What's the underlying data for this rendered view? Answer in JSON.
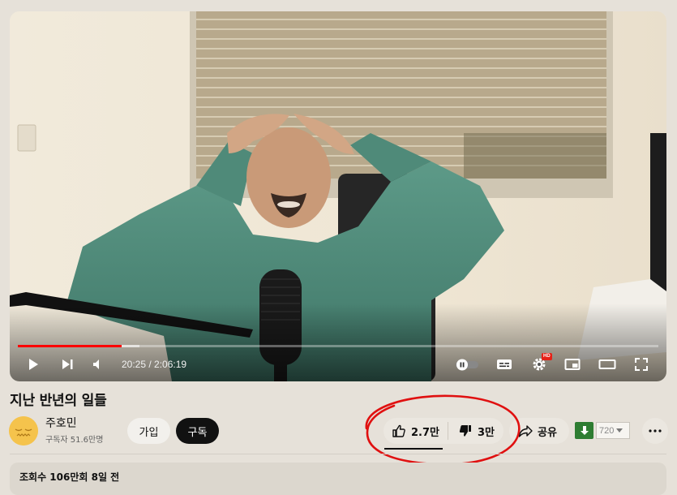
{
  "player": {
    "progress_fraction": 0.162,
    "buffer_fraction": 0.19,
    "time_display": "20:25 / 2:06:19",
    "hd_badge": "HD",
    "controls": [
      "play-icon",
      "next-icon",
      "volume-icon",
      "autoplay-toggle-icon",
      "subtitles-icon",
      "settings-icon",
      "miniplayer-icon",
      "theater-mode-icon",
      "fullscreen-icon"
    ]
  },
  "video": {
    "title": "지난 반년의 일들"
  },
  "channel": {
    "name": "주호민",
    "subscribers": "구독자 51.6만명",
    "join_label": "가입",
    "subscribe_label": "구독"
  },
  "actions": {
    "like_count": "2.7만",
    "dislike_count": "3만",
    "share_label": "공유",
    "download_quality": "720"
  },
  "description": {
    "meta": "조회수 106만회  8일 전"
  },
  "colors": {
    "background": "#e6e1d9",
    "progress": "#ff0000",
    "subscribe_bg": "#111111",
    "annotation": "#e01010",
    "download": "#2e7d32"
  }
}
